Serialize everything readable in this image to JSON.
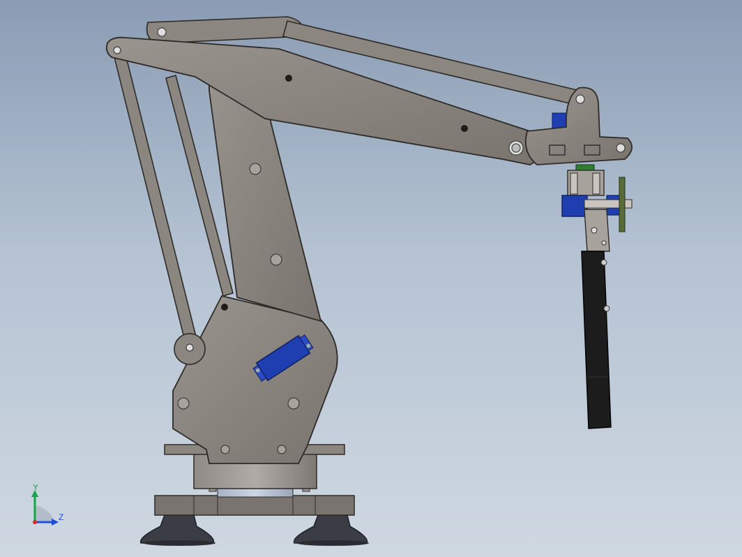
{
  "triad": {
    "y_label": "Y",
    "z_label": "Z",
    "colors": {
      "y_axis": "#16a34a",
      "z_axis": "#1d4ed8",
      "origin": "#dc2626"
    }
  },
  "colors": {
    "arm_body": "#8c8680",
    "arm_stroke": "#3f3a36",
    "servo_blue": "#1f3fb0",
    "gripper_black": "#1c1c1c",
    "suction_cup": "#3a3d44",
    "base_plate": "#7a7470"
  }
}
